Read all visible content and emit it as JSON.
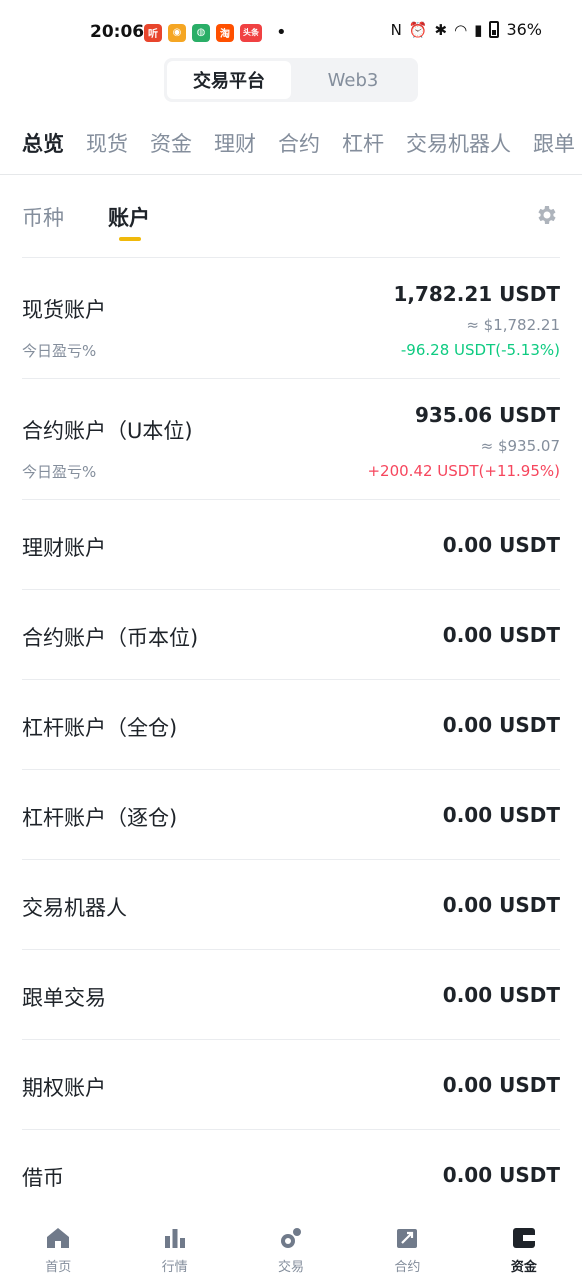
{
  "status_bar": {
    "time": "20:06",
    "battery": "36%",
    "apps": [
      {
        "icon": "listen-app-icon",
        "glyph": "听",
        "color": "#e8452c"
      },
      {
        "icon": "weibo-app-icon",
        "glyph": "◉",
        "color": "#f5a623"
      },
      {
        "icon": "wechat-app-icon",
        "glyph": "◍",
        "color": "#2aae67"
      },
      {
        "icon": "taobao-app-icon",
        "glyph": "淘",
        "color": "#ff5000"
      },
      {
        "icon": "toutiao-app-icon",
        "glyph": "头条",
        "color": "#f04142"
      }
    ],
    "dot": "•"
  },
  "platform": {
    "tabs": [
      "交易平台",
      "Web3"
    ],
    "active_index": 0
  },
  "top_tabs": [
    "总览",
    "现货",
    "资金",
    "理财",
    "合约",
    "杠杆",
    "交易机器人",
    "跟单"
  ],
  "sub_tabs": [
    "币种",
    "账户"
  ],
  "accounts": [
    {
      "name": "现货账户",
      "value": "1,782.21 USDT",
      "usd": "≈ $1,782.21",
      "sub": "今日盈亏%",
      "pnl": "-96.28 USDT(-5.13%)",
      "pnl_dir": "down"
    },
    {
      "name": "合约账户（U本位)",
      "value": "935.06 USDT",
      "usd": "≈ $935.07",
      "sub": "今日盈亏%",
      "pnl": "+200.42 USDT(+11.95%)",
      "pnl_dir": "up"
    },
    {
      "name": "理财账户",
      "value": "0.00 USDT"
    },
    {
      "name": "合约账户（币本位)",
      "value": "0.00 USDT"
    },
    {
      "name": "杠杆账户（全仓)",
      "value": "0.00 USDT"
    },
    {
      "name": "杠杆账户（逐仓)",
      "value": "0.00 USDT"
    },
    {
      "name": "交易机器人",
      "value": "0.00 USDT"
    },
    {
      "name": "跟单交易",
      "value": "0.00 USDT"
    },
    {
      "name": "期权账户",
      "value": "0.00 USDT"
    },
    {
      "name": "借币",
      "value": "0.00 USDT"
    }
  ],
  "bottom_nav": [
    {
      "label": "首页",
      "icon": "home-icon"
    },
    {
      "label": "行情",
      "icon": "markets-icon"
    },
    {
      "label": "交易",
      "icon": "trade-icon"
    },
    {
      "label": "合约",
      "icon": "futures-icon"
    },
    {
      "label": "资金",
      "icon": "wallet-icon"
    }
  ],
  "colors": {
    "accent": "#f0b90b",
    "down": "#0ecb81",
    "up": "#f6465d"
  }
}
